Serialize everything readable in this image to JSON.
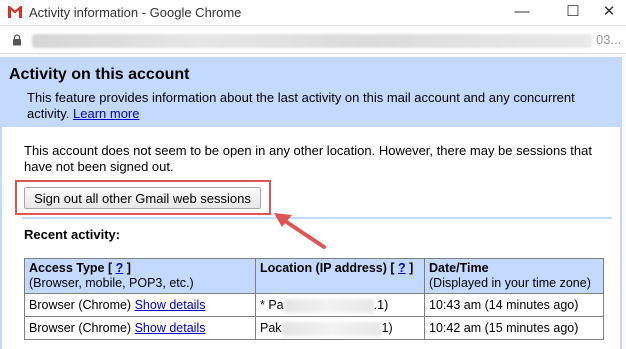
{
  "window": {
    "title": "Activity information - Google Chrome",
    "minimize": "—",
    "maximize": "☐",
    "close": "✕",
    "url_tail": "03..."
  },
  "page": {
    "title": "Activity on this account",
    "intro_text": "This feature provides information about the last activity on this mail account and any concurrent activity.",
    "learn_more": "Learn more",
    "notice": "This account does not seem to be open in any other location. However, there may be sessions that have not been signed out.",
    "signout_button": "Sign out all other Gmail web sessions",
    "recent_heading": "Recent activity:"
  },
  "table": {
    "headers": [
      {
        "label": "Access Type",
        "help": "?",
        "sub": "(Browser, mobile, POP3, etc.)"
      },
      {
        "label": "Location (IP address)",
        "help": "?",
        "sub": ""
      },
      {
        "label": "Date/Time",
        "help": "",
        "sub": "(Displayed in your time zone)"
      }
    ],
    "rows": [
      {
        "access": "Browser (Chrome)",
        "details": "Show details",
        "location_start": "* Pa",
        "location_end": ".1)",
        "time": "10:43 am (14 minutes ago)"
      },
      {
        "access": "Browser (Chrome)",
        "details": "Show details",
        "location_start": "Pak",
        "location_end": "1)",
        "time": "10:42 am (15 minutes ago)"
      }
    ]
  },
  "colors": {
    "accent_blue": "#c3d9ff",
    "link": "#0000cc",
    "highlight_red": "#e05455",
    "gmail_red": "#d93025"
  }
}
